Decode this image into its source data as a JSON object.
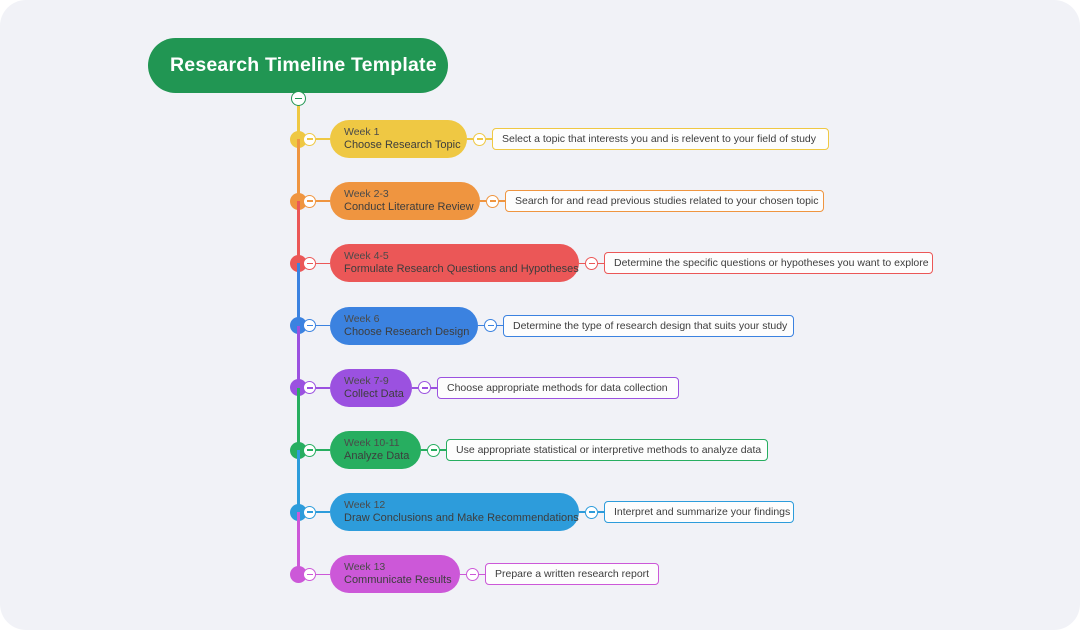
{
  "title": {
    "text": "Research Timeline Template",
    "color": "#219653"
  },
  "canvas": {
    "background": "#f1f2f7"
  },
  "root_toggle": {
    "icon": "collapse-minus-icon"
  },
  "items": [
    {
      "week": "Week 1",
      "task": "Choose Research Topic",
      "detail": "Select a topic that interests you and is relevent to your field of study",
      "color": "#EFC843",
      "pill_width": 137,
      "detail_width": 337
    },
    {
      "week": "Week 2-3",
      "task": "Conduct Literature Review",
      "detail": "Search for and read previous studies related to your chosen topic",
      "color": "#EF9540",
      "pill_width": 150,
      "detail_width": 319
    },
    {
      "week": "Week 4-5",
      "task": "Formulate Research Questions and Hypotheses",
      "detail": "Determine the specific questions or hypotheses you want to explore",
      "color": "#EB5757",
      "pill_width": 249,
      "detail_width": 329
    },
    {
      "week": "Week 6",
      "task": "Choose Research Design",
      "detail": "Determine the type of research design that suits your study",
      "color": "#3B82E0",
      "pill_width": 148,
      "detail_width": 291
    },
    {
      "week": "Week 7-9",
      "task": "Collect Data",
      "detail": "Choose appropriate methods for data collection",
      "color": "#9B51E0",
      "pill_width": 82,
      "detail_width": 242
    },
    {
      "week": "Week 10-11",
      "task": "Analyze Data",
      "detail": "Use appropriate statistical or interpretive methods to analyze data",
      "color": "#27AE60",
      "pill_width": 91,
      "detail_width": 322
    },
    {
      "week": "Week 12",
      "task": "Draw Conclusions and Make Recommendations",
      "detail": "Interpret and summarize your findings",
      "color": "#2D9CDB",
      "pill_width": 249,
      "detail_width": 190
    },
    {
      "week": "Week 13",
      "task": "Communicate Results",
      "detail": "Prepare a written research report",
      "color": "#CC58D8",
      "pill_width": 130,
      "detail_width": 174
    }
  ]
}
